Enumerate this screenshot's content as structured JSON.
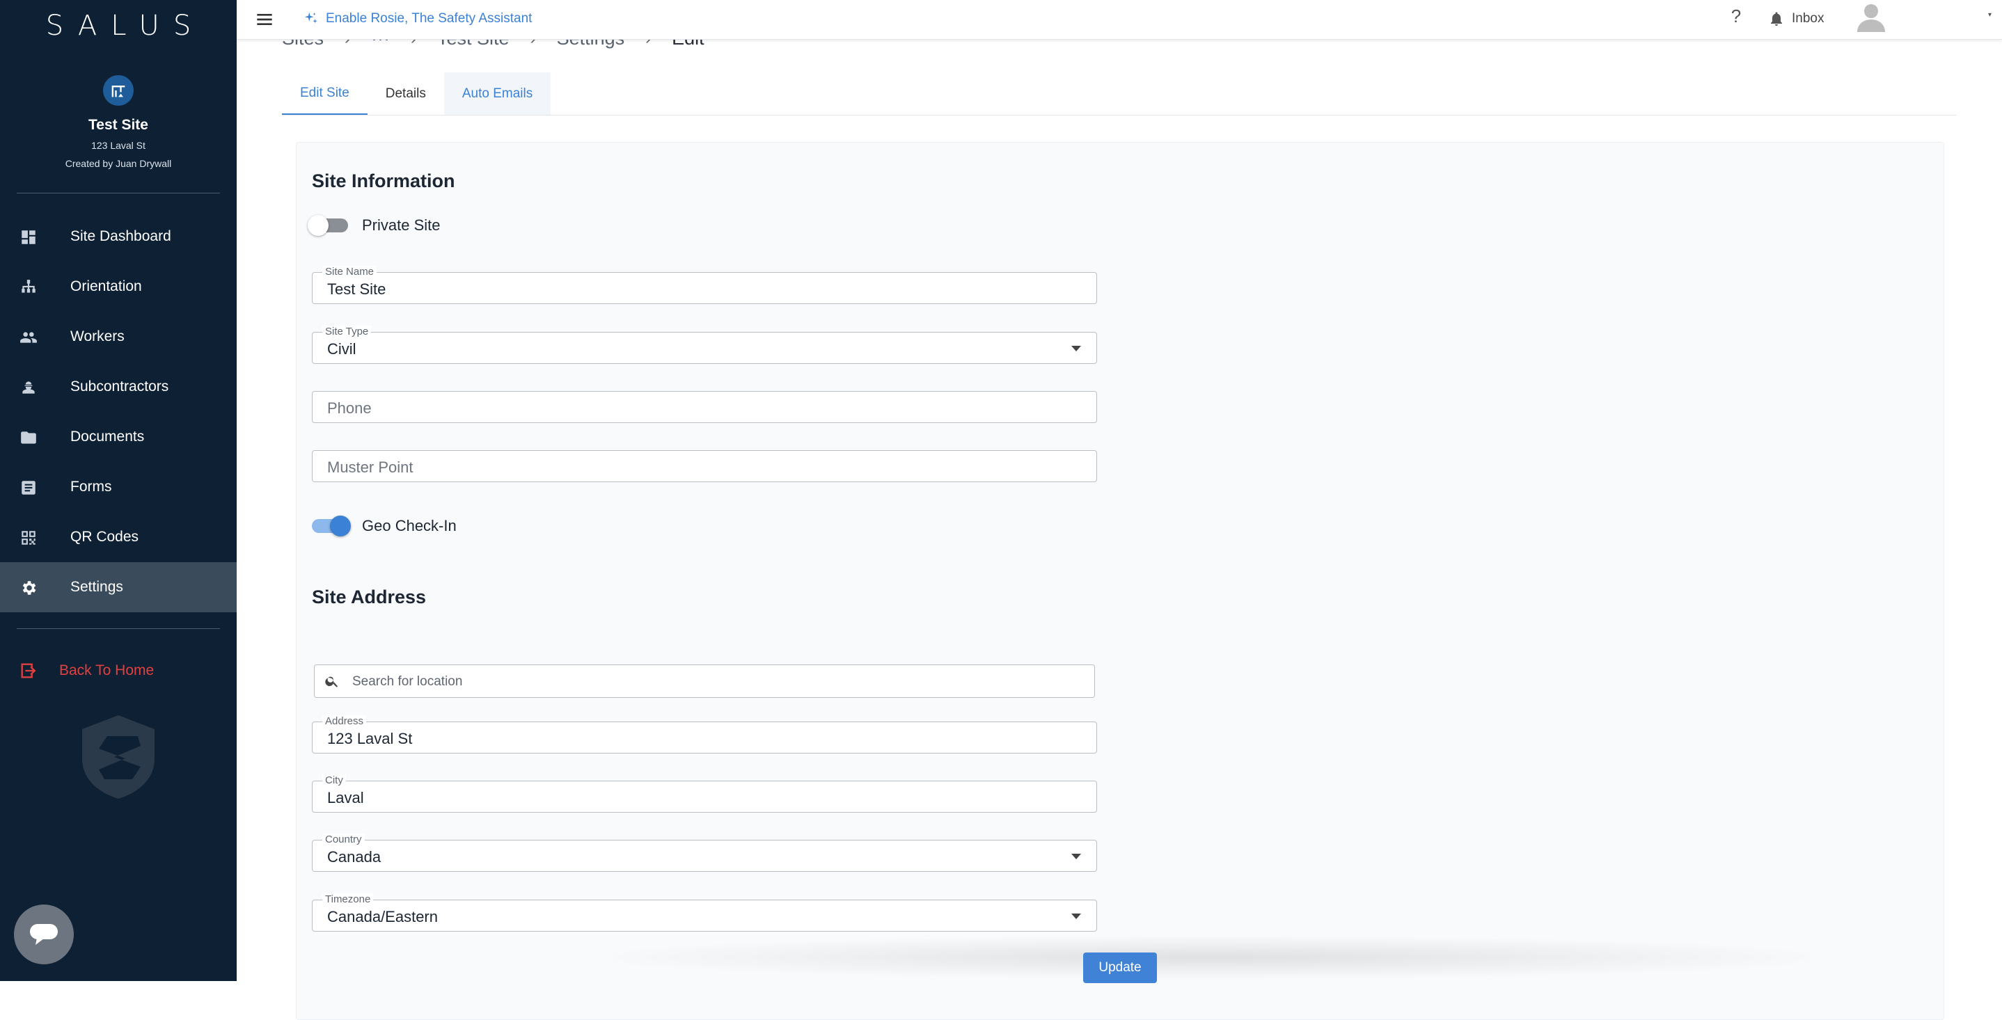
{
  "sidebar": {
    "logo": "SALUS",
    "site_name": "Test Site",
    "site_address": "123 Laval St",
    "created_by": "Created by Juan Drywall",
    "nav": [
      {
        "label": "Site Dashboard",
        "icon": "dashboard-icon"
      },
      {
        "label": "Orientation",
        "icon": "hierarchy-icon"
      },
      {
        "label": "Workers",
        "icon": "people-icon"
      },
      {
        "label": "Subcontractors",
        "icon": "engineer-icon"
      },
      {
        "label": "Documents",
        "icon": "folder-icon"
      },
      {
        "label": "Forms",
        "icon": "form-icon"
      },
      {
        "label": "QR Codes",
        "icon": "qr-code-icon"
      },
      {
        "label": "Settings",
        "icon": "gear-icon",
        "active": true
      }
    ],
    "back_home": "Back To Home",
    "back_home_color": "#e0403f"
  },
  "topbar": {
    "assistant_label": "Enable Rosie, The Safety Assistant",
    "help": "?",
    "inbox": "Inbox"
  },
  "breadcrumb": [
    "Sites",
    "···",
    "Test Site",
    "Settings",
    "Edit"
  ],
  "tabs": [
    "Edit Site",
    "Details",
    "Auto Emails"
  ],
  "form": {
    "site_info_title": "Site Information",
    "private_site_label": "Private Site",
    "private_site_on": false,
    "site_name_label": "Site Name",
    "site_name_value": "Test Site",
    "site_type_label": "Site Type",
    "site_type_value": "Civil",
    "phone_placeholder": "Phone",
    "muster_point_placeholder": "Muster Point",
    "geo_checkin_label": "Geo Check-In",
    "geo_checkin_on": true,
    "site_address_title": "Site Address",
    "search_placeholder": "Search for location",
    "address_label": "Address",
    "address_value": "123 Laval St",
    "city_label": "City",
    "city_value": "Laval",
    "country_label": "Country",
    "country_value": "Canada",
    "timezone_label": "Timezone",
    "timezone_value": "Canada/Eastern",
    "update_button": "Update"
  },
  "colors": {
    "sidebar_bg": "#0e2134",
    "accent": "#3b82d6",
    "active_nav": "#3a4b5c"
  }
}
